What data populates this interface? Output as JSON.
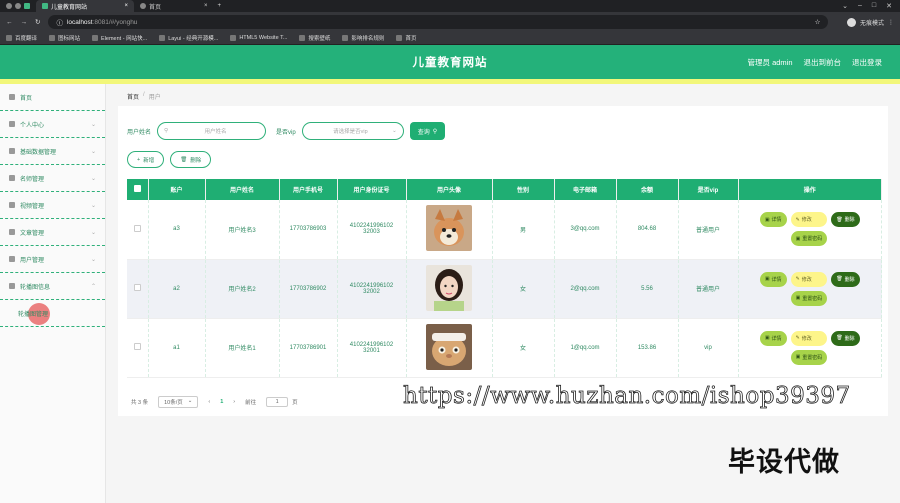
{
  "browser": {
    "tabs": [
      {
        "title": "儿童教育网站",
        "active": true
      },
      {
        "title": "首页",
        "active": false
      }
    ],
    "new_tab": "+",
    "url_host": "localhost",
    "url_rest": ":8081/#/yonghu",
    "profile": "无痕模式",
    "bookmarks": [
      "百度翻译",
      "图标网站",
      "Element - 网站快...",
      "Layui - 经典开源模...",
      "HTML5 Website T...",
      "搜索壁纸",
      "影响排名规则",
      "首页"
    ]
  },
  "header": {
    "title": "儿童教育网站",
    "admin": "管理员 admin",
    "to_front": "退出到前台",
    "logout": "退出登录"
  },
  "sidebar": {
    "items": [
      {
        "label": "首页",
        "icon": "home-icon",
        "chevron": false
      },
      {
        "label": "个人中心",
        "icon": "user-icon",
        "chevron": true
      },
      {
        "label": "基础数据管理",
        "icon": "data-icon",
        "chevron": true
      },
      {
        "label": "名师管理",
        "icon": "teacher-icon",
        "chevron": true
      },
      {
        "label": "视频管理",
        "icon": "video-icon",
        "chevron": true
      },
      {
        "label": "文章管理",
        "icon": "article-icon",
        "chevron": true
      },
      {
        "label": "用户管理",
        "icon": "users-icon",
        "chevron": true
      },
      {
        "label": "轮播图信息",
        "icon": "image-icon",
        "chevron": true
      }
    ],
    "sub_item": "轮播图管理"
  },
  "breadcrumb": {
    "home": "首页",
    "sep": "/",
    "current": "用户"
  },
  "search": {
    "name_label": "用户姓名",
    "name_placeholder": "用户姓名",
    "vip_label": "是否vip",
    "vip_placeholder": "请选择是否vip",
    "button": "查询"
  },
  "actions": {
    "add": "新增",
    "delete": "删除"
  },
  "table": {
    "headers": [
      "账户",
      "用户姓名",
      "用户手机号",
      "用户身份证号",
      "用户头像",
      "性别",
      "电子邮箱",
      "余额",
      "是否vip",
      "操作"
    ],
    "rows": [
      {
        "account": "a3",
        "name": "用户姓名3",
        "phone": "17703786903",
        "id1": "4102241996102",
        "id2": "32003",
        "gender": "男",
        "email": "3@qq.com",
        "balance": "804.68",
        "vip": "普通用户",
        "photo": "dog"
      },
      {
        "account": "a2",
        "name": "用户姓名2",
        "phone": "17703786902",
        "id1": "4102241996102",
        "id2": "32002",
        "gender": "女",
        "email": "2@qq.com",
        "balance": "5.56",
        "vip": "普通用户",
        "photo": "girl"
      },
      {
        "account": "a1",
        "name": "用户姓名1",
        "phone": "17703786901",
        "id1": "4102241996102",
        "id2": "32001",
        "gender": "女",
        "email": "1@qq.com",
        "balance": "153.86",
        "vip": "vip",
        "photo": "cat"
      }
    ],
    "ops": {
      "detail": "详情",
      "edit": "修改",
      "del": "删除",
      "reset": "重置密码"
    }
  },
  "pager": {
    "total": "共 3 条",
    "size": "10条/页",
    "prev": "‹",
    "page": "1",
    "next": "›",
    "goto_label": "前往",
    "goto_value": "1",
    "goto_unit": "页"
  },
  "overlay": {
    "watermark": "https://www.huzhan.com/ishop39397",
    "stamp": "毕设代做"
  }
}
